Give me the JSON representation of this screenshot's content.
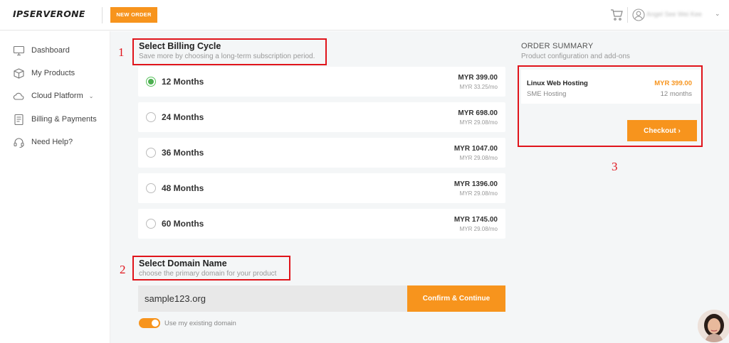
{
  "header": {
    "logo": "IPSERVERONE",
    "new_order": "NEW ORDER",
    "user_name": "Angel See Wei Kee"
  },
  "sidebar": {
    "items": [
      {
        "label": "Dashboard",
        "icon": "monitor-icon"
      },
      {
        "label": "My Products",
        "icon": "box-icon"
      },
      {
        "label": "Cloud Platform",
        "icon": "cloud-icon"
      },
      {
        "label": "Billing & Payments",
        "icon": "invoice-icon"
      },
      {
        "label": "Need Help?",
        "icon": "headset-icon"
      }
    ]
  },
  "annotations": [
    "1",
    "2",
    "3"
  ],
  "billing": {
    "title": "Select Billing Cycle",
    "subtitle": "Save more by choosing a long-term subscription period.",
    "plans": [
      {
        "label": "12 Months",
        "price": "MYR 399.00",
        "monthly": "MYR 33.25/mo",
        "selected": true
      },
      {
        "label": "24 Months",
        "price": "MYR 698.00",
        "monthly": "MYR 29.08/mo",
        "selected": false
      },
      {
        "label": "36 Months",
        "price": "MYR 1047.00",
        "monthly": "MYR 29.08/mo",
        "selected": false
      },
      {
        "label": "48 Months",
        "price": "MYR 1396.00",
        "monthly": "MYR 29.08/mo",
        "selected": false
      },
      {
        "label": "60 Months",
        "price": "MYR 1745.00",
        "monthly": "MYR 29.08/mo",
        "selected": false
      }
    ]
  },
  "domain": {
    "title": "Select Domain Name",
    "subtitle": "choose the primary domain for your product",
    "value": "sample123.org",
    "confirm_label": "Confirm & Continue",
    "toggle_label": "Use my existing domain",
    "toggle_on": true
  },
  "summary": {
    "title": "ORDER SUMMARY",
    "subtitle": "Product configuration and add-ons",
    "product_name": "Linux Web Hosting",
    "product_plan": "SME Hosting",
    "price": "MYR 399.00",
    "term": "12 months",
    "checkout_label": "Checkout"
  },
  "colors": {
    "accent": "#f7941d",
    "annotation": "#e0141b",
    "selected_radio": "#4caf50"
  }
}
